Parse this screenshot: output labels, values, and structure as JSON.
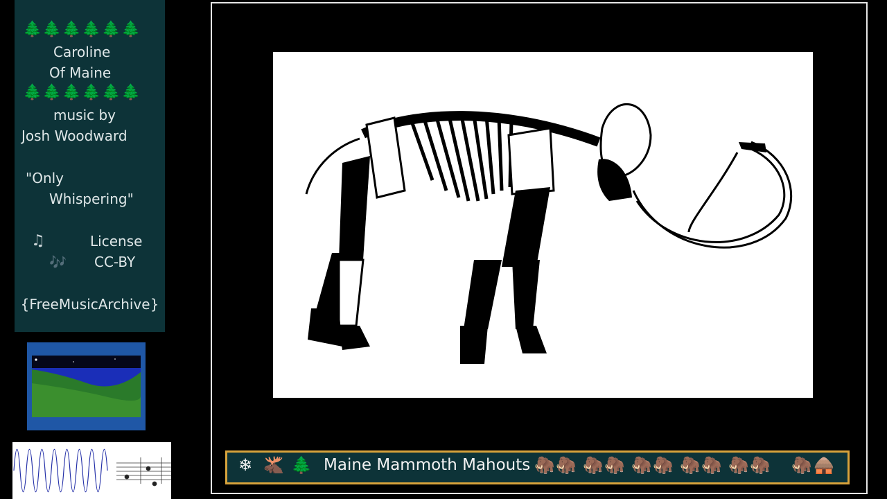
{
  "panel": {
    "trees": "🌲🌲🌲🌲🌲🌲",
    "artist_line1": "Caroline",
    "artist_line2": "Of Maine",
    "music_by": "music by",
    "composer": "Josh Woodward",
    "song_line1": "\"Only",
    "song_line2": "Whispering\"",
    "note_single": "♫",
    "note_double": "🎶",
    "license_label": "License",
    "license_value": "CC-BY",
    "source": "{FreeMusicArchive}"
  },
  "bottom_bar": {
    "title": "Maine Mammoth Mahouts",
    "icons_left": [
      "❄",
      "🫎",
      "🌲"
    ],
    "icons_right": [
      "🦣",
      "🦣",
      "🦣",
      "🦣",
      "🦣",
      "🦣",
      "🦣",
      "🦣",
      "🦣",
      "🦣",
      "🦣",
      "🛖"
    ],
    "icon_names": [
      "snowflake-icon",
      "moose-icon",
      "tree-icon",
      "mammoth-icon",
      "hut-icon"
    ]
  },
  "colors": {
    "panel_bg": "#0d3338",
    "frame_border": "#e6e6e6",
    "bar_border": "#d8a33c",
    "thumb_border": "#1f57a6",
    "background": "#000000"
  }
}
